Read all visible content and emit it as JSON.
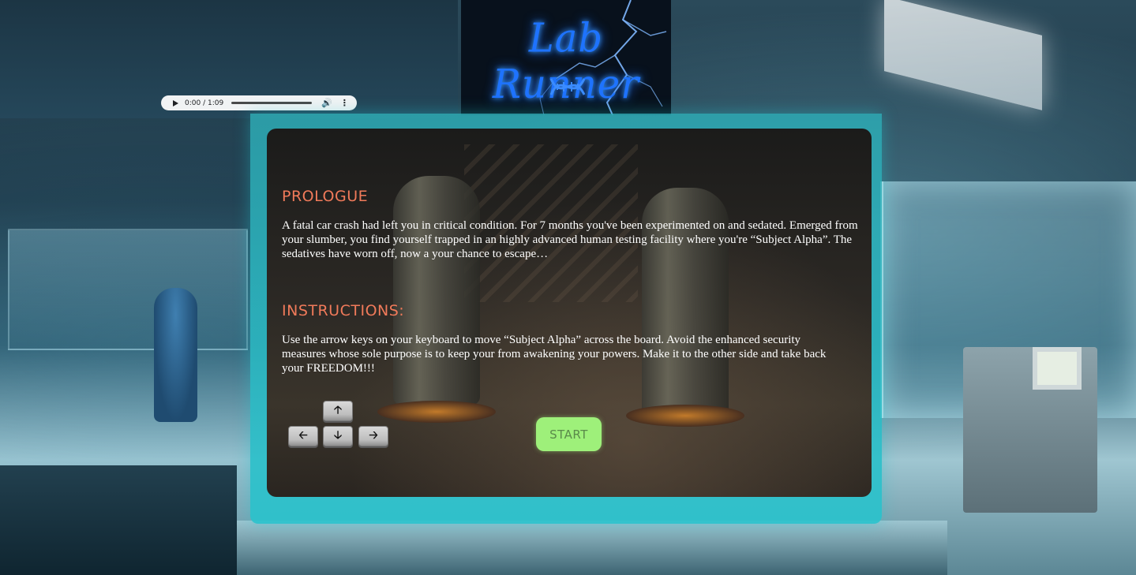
{
  "logo": {
    "title": "Lab Runner",
    "icon": "dna-icon",
    "glow_color": "#1e73ff"
  },
  "audio": {
    "time": "0:00 / 1:09",
    "play_icon": "play-icon",
    "volume_icon": "volume-icon",
    "more_icon": "more-vert-icon"
  },
  "prologue": {
    "heading": "PROLOGUE",
    "text": "A fatal car crash had left you in critical condition. For 7 months you've been experimented on and sedated. Emerged from your slumber, you find yourself trapped in an highly advanced human testing facility where you're “Subject Alpha”. The sedatives have worn off, now a your chance to escape…"
  },
  "instructions": {
    "heading": "INSTRUCTIONS:",
    "text": "Use the arrow keys on your keyboard to move “Subject Alpha” across the board. Avoid the enhanced security measures whose sole purpose is to keep your from awakening your powers. Make it to the other side and take back your FREEDOM!!!"
  },
  "keys": {
    "up": "🡡",
    "left": "🡠",
    "down": "🡣",
    "right": "🡢"
  },
  "start_button": {
    "label": "START",
    "color": "#9ef07a"
  },
  "theme": {
    "heading_color": "#f07a5a",
    "frame_color": "#2dc3cd"
  }
}
